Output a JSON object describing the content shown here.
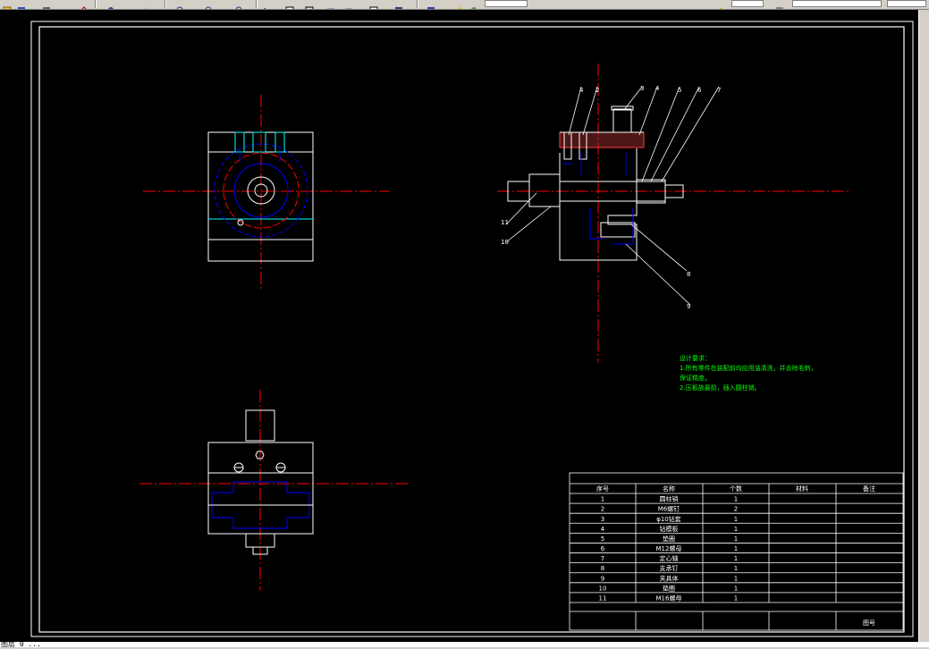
{
  "toolbar": {
    "icons": [
      "open-icon",
      "save-icon",
      "print-icon",
      "undo-icon",
      "pan-icon",
      "zoom-icon",
      "zoom-window-icon",
      "zoom-previous-icon",
      "text-style-icon",
      "properties-icon",
      "layer-icon",
      "color-icon",
      "linetype-icon"
    ]
  },
  "status": {
    "text": "图层 0 ..."
  },
  "annotations": {
    "view_top": [
      "4",
      "2",
      "3",
      "4",
      "5",
      "6",
      "7"
    ],
    "view_left": [
      "11",
      "10"
    ],
    "view_right": [
      "8",
      "9"
    ]
  },
  "notes": {
    "title": "设计要求：",
    "lines": [
      "1.所有零件在装配前均应用油清洗，并去除毛刺，",
      "保证精度。",
      "2.压板放最前，插入圆柱销。"
    ]
  },
  "bom": {
    "headers": [
      "序号",
      "名称",
      "个数",
      "材料",
      "备注"
    ],
    "rows": [
      [
        "1",
        "圆柱销",
        "1",
        "",
        ""
      ],
      [
        "2",
        "M6螺钉",
        "2",
        "",
        ""
      ],
      [
        "3",
        "φ10钻套",
        "1",
        "",
        ""
      ],
      [
        "4",
        "钻模板",
        "1",
        "",
        ""
      ],
      [
        "5",
        "垫圈",
        "1",
        "",
        ""
      ],
      [
        "6",
        "M12螺母",
        "1",
        "",
        ""
      ],
      [
        "7",
        "定心轴",
        "1",
        "",
        ""
      ],
      [
        "8",
        "支承钉",
        "1",
        "",
        ""
      ],
      [
        "9",
        "夹具体",
        "1",
        "",
        ""
      ],
      [
        "10",
        "垫圈",
        "1",
        "",
        ""
      ],
      [
        "11",
        "M16螺母",
        "1",
        "",
        ""
      ]
    ],
    "footer_label": "图号"
  },
  "colors": {
    "bg": "#000000",
    "line": "#ffffff",
    "center": "#ff0000",
    "hidden": "#0000ff",
    "cyan": "#00ffff",
    "green": "#00ff00",
    "hatch": "#ff3a3a"
  }
}
